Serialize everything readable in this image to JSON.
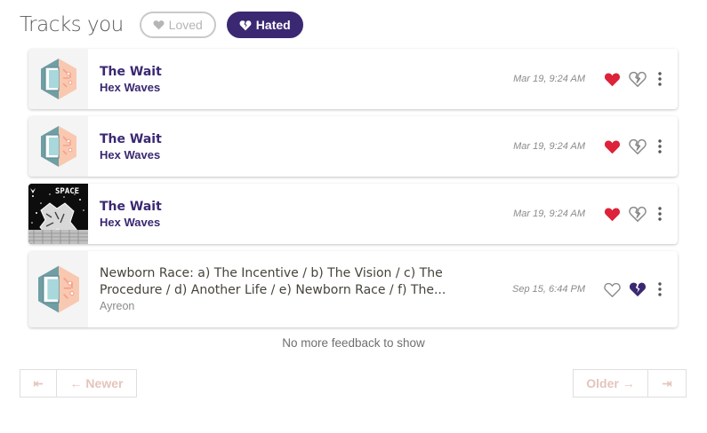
{
  "header": {
    "title": "Tracks you",
    "loved_label": "Loved",
    "hated_label": "Hated"
  },
  "feedback": [
    {
      "track": "The Wait",
      "artist": "Hex Waves",
      "time": "Mar 19, 9:24 AM",
      "loved": true,
      "hated": false,
      "cover": "placeholder"
    },
    {
      "track": "The Wait",
      "artist": "Hex Waves",
      "time": "Mar 19, 9:24 AM",
      "loved": true,
      "hated": false,
      "cover": "placeholder"
    },
    {
      "track": "The Wait",
      "artist": "Hex Waves",
      "time": "Mar 19, 9:24 AM",
      "loved": true,
      "hated": false,
      "cover": "art",
      "cover_text": "SPACE"
    },
    {
      "track": "Newborn Race: a) The Incentive / b) The Vision / c) The Procedure / d) Another Life / e) Newborn Race / f) The...",
      "artist": "Ayreon",
      "time": "Sep 15, 6:44 PM",
      "loved": false,
      "hated": true,
      "cover": "placeholder"
    }
  ],
  "empty_message": "No more feedback to show",
  "pagination": {
    "first_label": "⇤",
    "newer_label": "← Newer",
    "older_label": "Older →",
    "last_label": "⇥"
  },
  "colors": {
    "accent": "#3b2872",
    "heart_red": "#dc2339",
    "pager_text": "#e4c4bb"
  }
}
